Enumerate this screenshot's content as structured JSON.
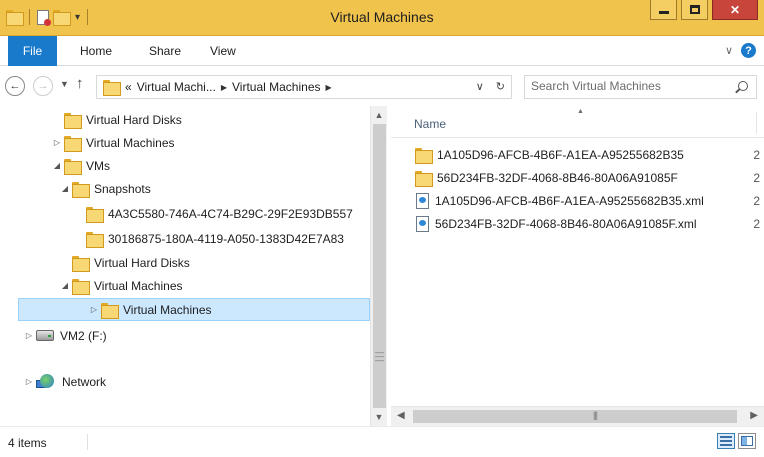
{
  "window": {
    "title": "Virtual Machines"
  },
  "ribbon": {
    "tabs": [
      "File",
      "Home",
      "Share",
      "View"
    ]
  },
  "address": {
    "crumbs": [
      "«",
      "Virtual Machi...",
      "Virtual Machines"
    ],
    "search_placeholder": "Search Virtual Machines"
  },
  "nav_tree": [
    {
      "label": "Virtual Hard Disks",
      "indent": 4,
      "expander": "",
      "icon": "folder-icon"
    },
    {
      "label": "Virtual Machines",
      "indent": 4,
      "expander": "▷",
      "icon": "folder-icon"
    },
    {
      "label": "VMs",
      "indent": 4,
      "expander": "◢",
      "icon": "folder-icon"
    },
    {
      "label": "Snapshots",
      "indent": 5,
      "expander": "◢",
      "icon": "folder-icon"
    },
    {
      "label": "4A3C5580-746A-4C74-B29C-29F2E93DB557",
      "indent": 6,
      "expander": "",
      "icon": "folder-icon"
    },
    {
      "label": "30186875-180A-4119-A050-1383D42E7A83",
      "indent": 6,
      "expander": "",
      "icon": "folder-icon"
    },
    {
      "label": "Virtual Hard Disks",
      "indent": 5,
      "expander": "",
      "icon": "folder-icon"
    },
    {
      "label": "Virtual Machines",
      "indent": 5,
      "expander": "◢",
      "icon": "folder-icon"
    },
    {
      "label": "Virtual Machines",
      "indent": 6,
      "expander": "▷",
      "icon": "folder-icon",
      "selected": true
    },
    {
      "label": "VM2 (F:)",
      "indent": 1,
      "expander": "▷",
      "icon": "drive-icon"
    },
    {
      "label": "Network",
      "indent": 1,
      "expander": "▷",
      "icon": "network-icon"
    }
  ],
  "content": {
    "column_name": "Name",
    "files": [
      {
        "name": "1A105D96-AFCB-4B6F-A1EA-A95255682B35",
        "type": "folder"
      },
      {
        "name": "56D234FB-32DF-4068-8B46-80A06A91085F",
        "type": "folder"
      },
      {
        "name": "1A105D96-AFCB-4B6F-A1EA-A95255682B35.xml",
        "type": "xml"
      },
      {
        "name": "56D234FB-32DF-4068-8B46-80A06A91085F.xml",
        "type": "xml"
      }
    ],
    "truncated_col_char": "2"
  },
  "status": {
    "item_count": "4 items"
  }
}
